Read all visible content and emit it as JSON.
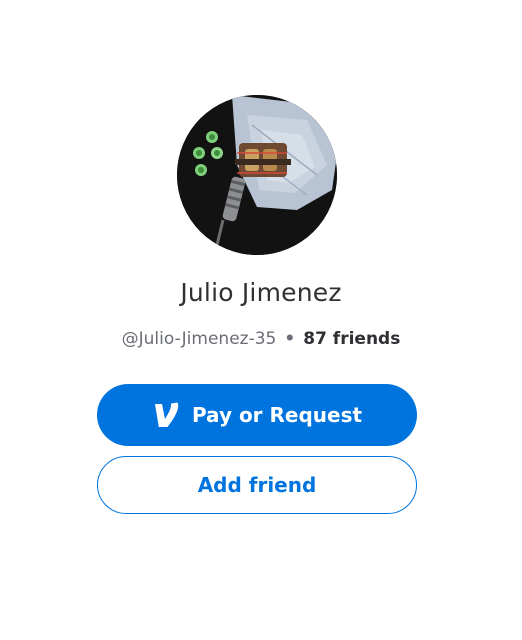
{
  "profile": {
    "name": "Julio Jimenez",
    "username": "@Julio-Jimenez-35",
    "separator": "•",
    "friends": "87 friends"
  },
  "actions": {
    "pay_label": "Pay or Request",
    "add_friend_label": "Add friend"
  },
  "icons": {
    "pay_button_icon": "venmo-logo-icon"
  },
  "colors": {
    "accent": "#0074de",
    "name_text": "#2f3033",
    "meta_text": "#6b6e76"
  }
}
